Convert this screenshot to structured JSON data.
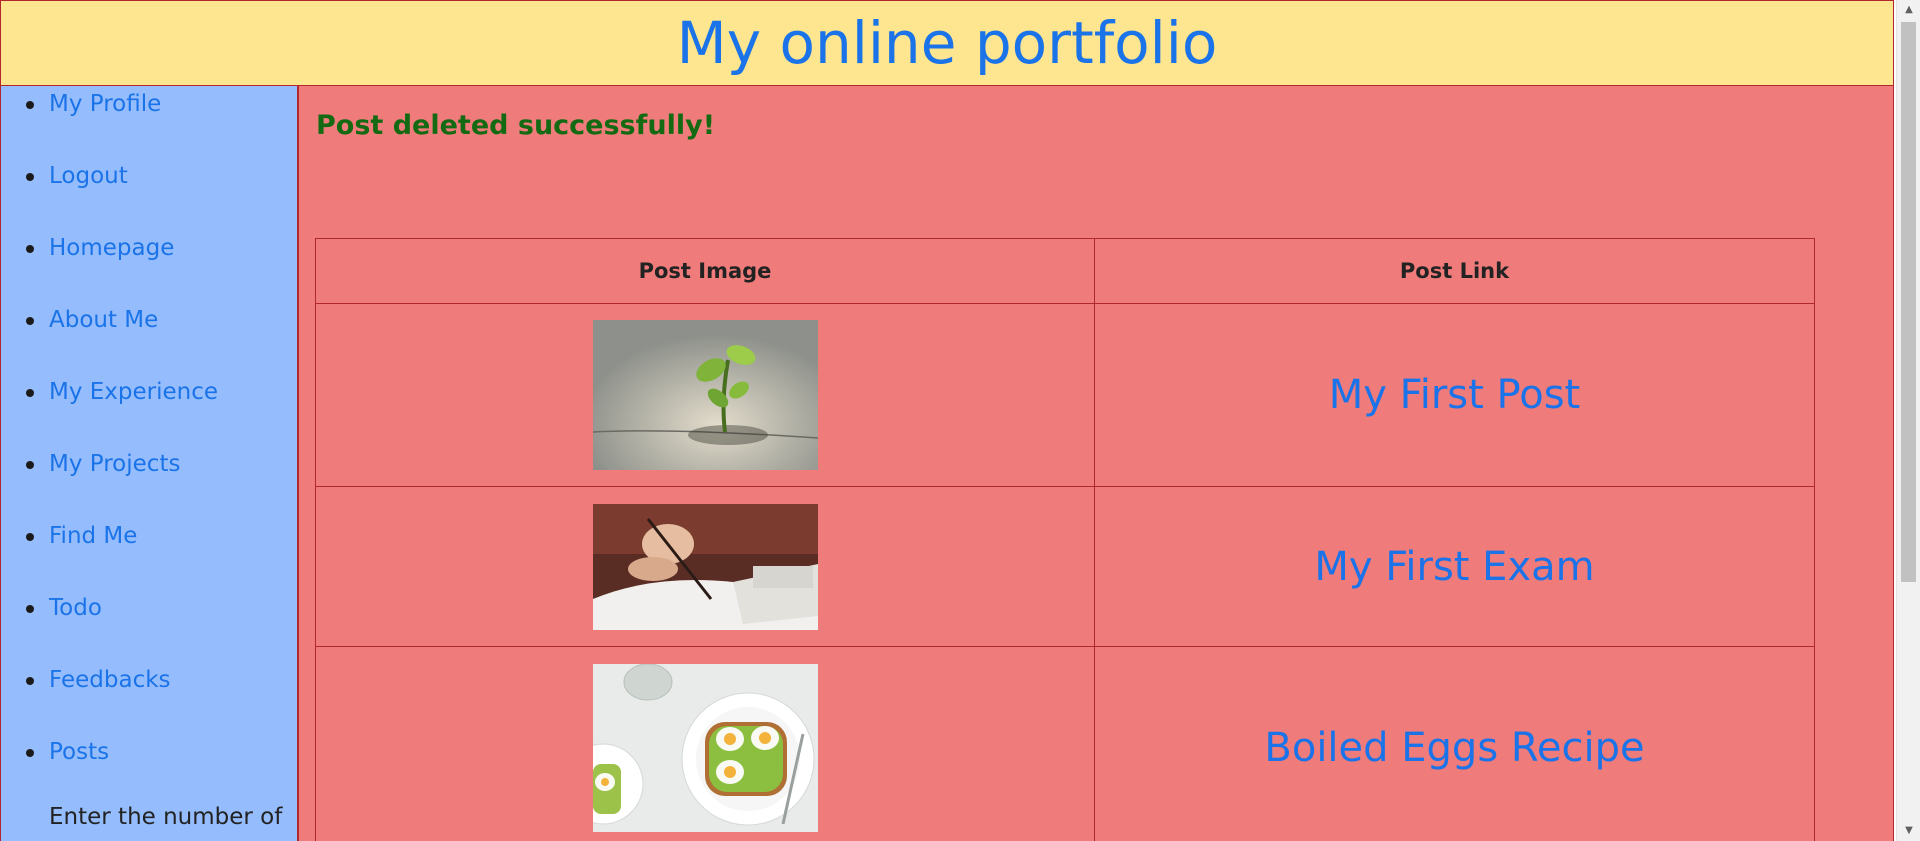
{
  "header": {
    "title": "My online portfolio"
  },
  "sidebar": {
    "items": [
      {
        "label": "My Profile"
      },
      {
        "label": "Logout"
      },
      {
        "label": "Homepage"
      },
      {
        "label": "About Me"
      },
      {
        "label": "My Experience"
      },
      {
        "label": "My Projects"
      },
      {
        "label": "Find Me"
      },
      {
        "label": "Todo"
      },
      {
        "label": "Feedbacks"
      },
      {
        "label": "Posts"
      }
    ],
    "note": "Enter the number of"
  },
  "main": {
    "status_message": "Post deleted successfully!",
    "table": {
      "headers": [
        "Post Image",
        "Post Link"
      ],
      "rows": [
        {
          "image": "plant-sprout-image",
          "link": "My First Post"
        },
        {
          "image": "writing-exam-image",
          "link": "My First Exam"
        },
        {
          "image": "boiled-eggs-toast-image",
          "link": "Boiled Eggs Recipe"
        }
      ]
    }
  },
  "colors": {
    "header_bg": "#fee58f",
    "sidebar_bg": "#95bdfd",
    "main_bg": "#ef7c7b",
    "border": "#b0282d",
    "link": "#1a73e8",
    "success": "#146a13"
  }
}
